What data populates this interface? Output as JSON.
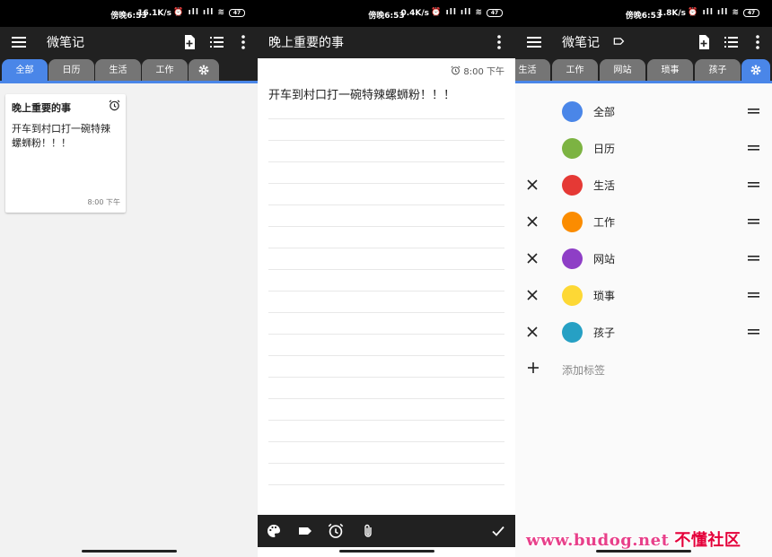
{
  "screen1": {
    "status": {
      "time": "傍晚6:53",
      "net": "16.1K/s",
      "battery": "47"
    },
    "app_title": "微笔记",
    "tabs": [
      "全部",
      "日历",
      "生活",
      "工作"
    ],
    "active_tab": "全部",
    "note": {
      "title": "晚上重要的事",
      "body": "开车到村口打一碗特辣螺蛳粉！！！",
      "time": "8:00 下午"
    }
  },
  "screen2": {
    "status": {
      "time": "傍晚6:53",
      "net": "0.4K/s",
      "battery": "47"
    },
    "title": "晚上重要的事",
    "reminder": "8:00 下午",
    "body": "开车到村口打一碗特辣螺蛳粉！！！"
  },
  "screen3": {
    "status": {
      "time": "傍晚6:53",
      "net": "1.8K/s",
      "battery": "47"
    },
    "app_title": "微笔记",
    "tabs": [
      "生活",
      "工作",
      "网站",
      "琐事",
      "孩子"
    ],
    "labels": [
      {
        "name": "全部",
        "color": "#4a86e8",
        "deletable": false
      },
      {
        "name": "日历",
        "color": "#7cb342",
        "deletable": false
      },
      {
        "name": "生活",
        "color": "#e53935",
        "deletable": true
      },
      {
        "name": "工作",
        "color": "#fb8c00",
        "deletable": true
      },
      {
        "name": "网站",
        "color": "#8e3ec6",
        "deletable": true
      },
      {
        "name": "琐事",
        "color": "#fdd835",
        "deletable": true
      },
      {
        "name": "孩子",
        "color": "#26a0c4",
        "deletable": true
      }
    ],
    "add_label": "添加标签"
  },
  "watermark": {
    "url": "www.budog.net",
    "name": "不懂社区"
  }
}
